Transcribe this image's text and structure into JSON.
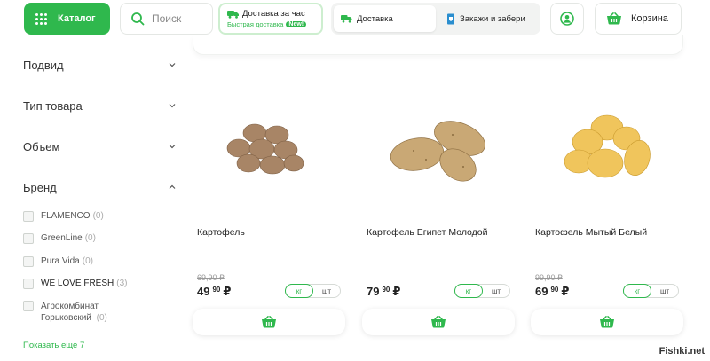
{
  "header": {
    "catalog_label": "Каталог",
    "search_placeholder": "Поиск",
    "express_title": "Доставка за час",
    "express_subtitle": "Быстрая доставка",
    "express_badge": "New!",
    "delivery_label": "Доставка",
    "pickup_label": "Закажи и забери",
    "cart_label": "Корзина"
  },
  "sidebar": {
    "filters": [
      {
        "label": "Подвид",
        "expanded": false
      },
      {
        "label": "Тип товара",
        "expanded": false
      },
      {
        "label": "Объем",
        "expanded": false
      },
      {
        "label": "Бренд",
        "expanded": true
      }
    ],
    "brands": [
      {
        "name": "FLAMENCO",
        "count": "(0)"
      },
      {
        "name": "GreenLine",
        "count": "(0)"
      },
      {
        "name": "Pura Vida",
        "count": "(0)"
      },
      {
        "name": "WE LOVE FRESH",
        "count": "(3)"
      },
      {
        "name": "Агрокомбинат Горьковский",
        "count": "(0)"
      }
    ],
    "show_more": "Показать еще 7"
  },
  "products": [
    {
      "name": "Картофель",
      "old_price": "69,90 ₽",
      "price_rub": "49",
      "price_kop": "90",
      "currency": "₽",
      "unit_kg": "кг",
      "unit_pcs": "шт"
    },
    {
      "name": "Картофель Египет Молодой",
      "old_price": "",
      "price_rub": "79",
      "price_kop": "90",
      "currency": "₽",
      "unit_kg": "кг",
      "unit_pcs": "шт"
    },
    {
      "name": "Картофель Мытый Белый",
      "old_price": "99,90 ₽",
      "price_rub": "69",
      "price_kop": "90",
      "currency": "₽",
      "unit_kg": "кг",
      "unit_pcs": "шт"
    }
  ],
  "watermark": "Fishki.net",
  "colors": {
    "accent": "#2fb84d",
    "text": "#222222"
  }
}
